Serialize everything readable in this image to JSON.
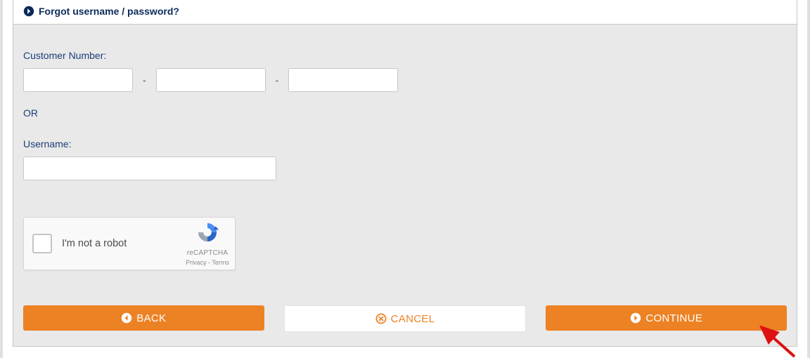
{
  "header": {
    "title": "Forgot username / password?"
  },
  "form": {
    "customer_number_label": "Customer Number:",
    "segment_separator": "-",
    "segments": {
      "a": "",
      "b": "",
      "c": ""
    },
    "or_label": "OR",
    "username_label": "Username:",
    "username_value": ""
  },
  "captcha": {
    "text": "I'm not a robot",
    "brand": "reCAPTCHA",
    "privacy": "Privacy",
    "dot": " - ",
    "terms": "Terms"
  },
  "buttons": {
    "back": "BACK",
    "cancel": "CANCEL",
    "continue": "CONTINUE"
  },
  "colors": {
    "accent_orange": "#ed8224",
    "brand_navy": "#0b2a5b"
  }
}
